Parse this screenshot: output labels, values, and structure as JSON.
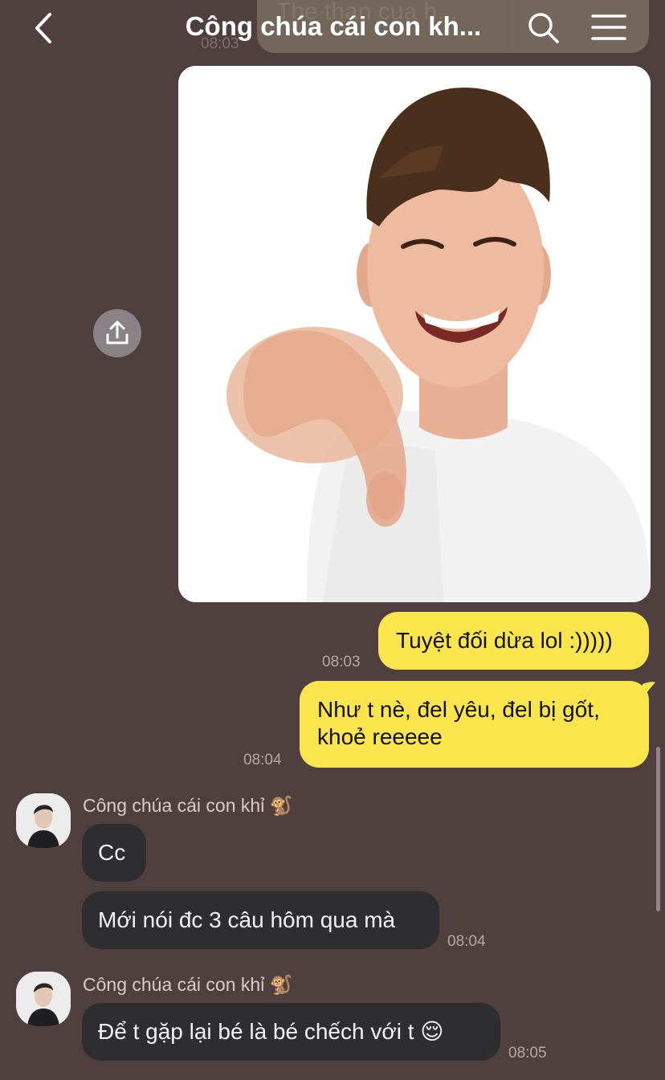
{
  "header": {
    "title": "Công chúa cái con kh..."
  },
  "previous_message": {
    "text": "The than cua h...",
    "time": "08:03"
  },
  "messages": {
    "m1_text": "Tuyệt đối dừa lol :)))))",
    "m1_time": "08:03",
    "m2_line1": "Như t nè, đel yêu, đel bị gốt,",
    "m2_line2": "khoẻ reeeee",
    "m2_time": "08:04",
    "sender1_name": "Công chúa cái con khỉ 🐒",
    "m3_text": "Cc",
    "m4_text": "Mới nói đc 3 câu hôm qua mà",
    "m4_time": "08:04",
    "sender2_name": "Công chúa cái con khỉ 🐒",
    "m5_text": "Để t gặp lại bé là bé chếch với t 😌",
    "m5_time": "08:05"
  },
  "colors": {
    "background": "#4f3f3f",
    "my_bubble": "#fbe54d",
    "other_bubble": "#2e2e30"
  },
  "icons": [
    "back-icon",
    "search-icon",
    "menu-icon",
    "share-icon"
  ]
}
